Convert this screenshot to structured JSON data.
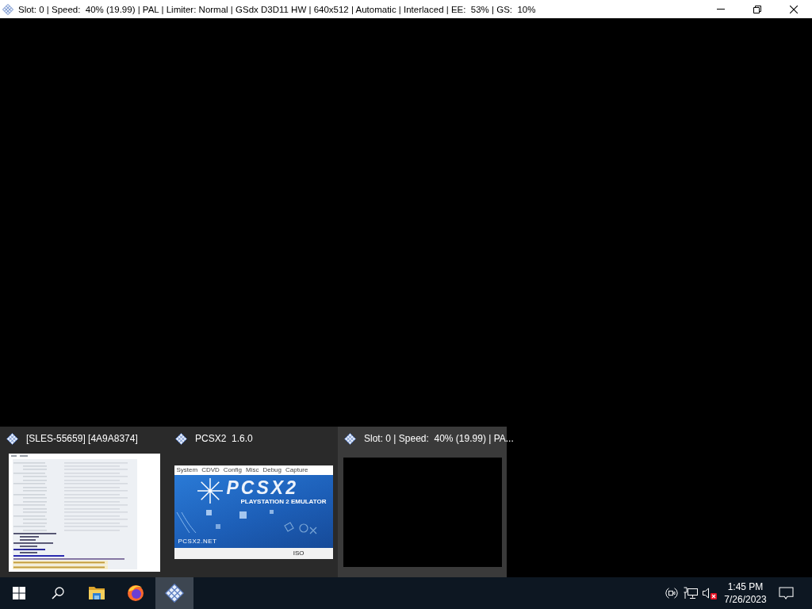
{
  "window": {
    "title": "Slot: 0 | Speed:  40% (19.99) | PAL | Limiter: Normal | GSdx D3D11 HW | 640x512 | Automatic | Interlaced | EE:  53% | GS:  10%"
  },
  "thumbnail_popup": {
    "items": [
      {
        "title": "[SLES-55659] [4A9A8374]",
        "kind": "log",
        "selected": false
      },
      {
        "title": "PCSX2  1.6.0",
        "kind": "main",
        "selected": false,
        "preview": {
          "menu": [
            "System",
            "CDVD",
            "Config",
            "Misc",
            "Debug",
            "Capture"
          ],
          "logo": "PCSX2",
          "tagline": "PLAYSTATION 2 EMULATOR",
          "website": "PCSX2.NET",
          "status": "ISO"
        }
      },
      {
        "title": "Slot: 0 | Speed:  40% (19.99) | PA...",
        "kind": "game",
        "selected": true
      }
    ]
  },
  "taskbar": {
    "buttons": [
      {
        "kind": "start",
        "selected": false
      },
      {
        "kind": "search",
        "selected": false
      },
      {
        "kind": "folder",
        "selected": false
      },
      {
        "kind": "browser",
        "selected": false
      },
      {
        "kind": "emulator",
        "selected": true
      }
    ],
    "tray": {
      "volume": {
        "muted": true
      }
    },
    "clock": {
      "time": "1:45 PM",
      "date": "7/26/2023"
    }
  }
}
